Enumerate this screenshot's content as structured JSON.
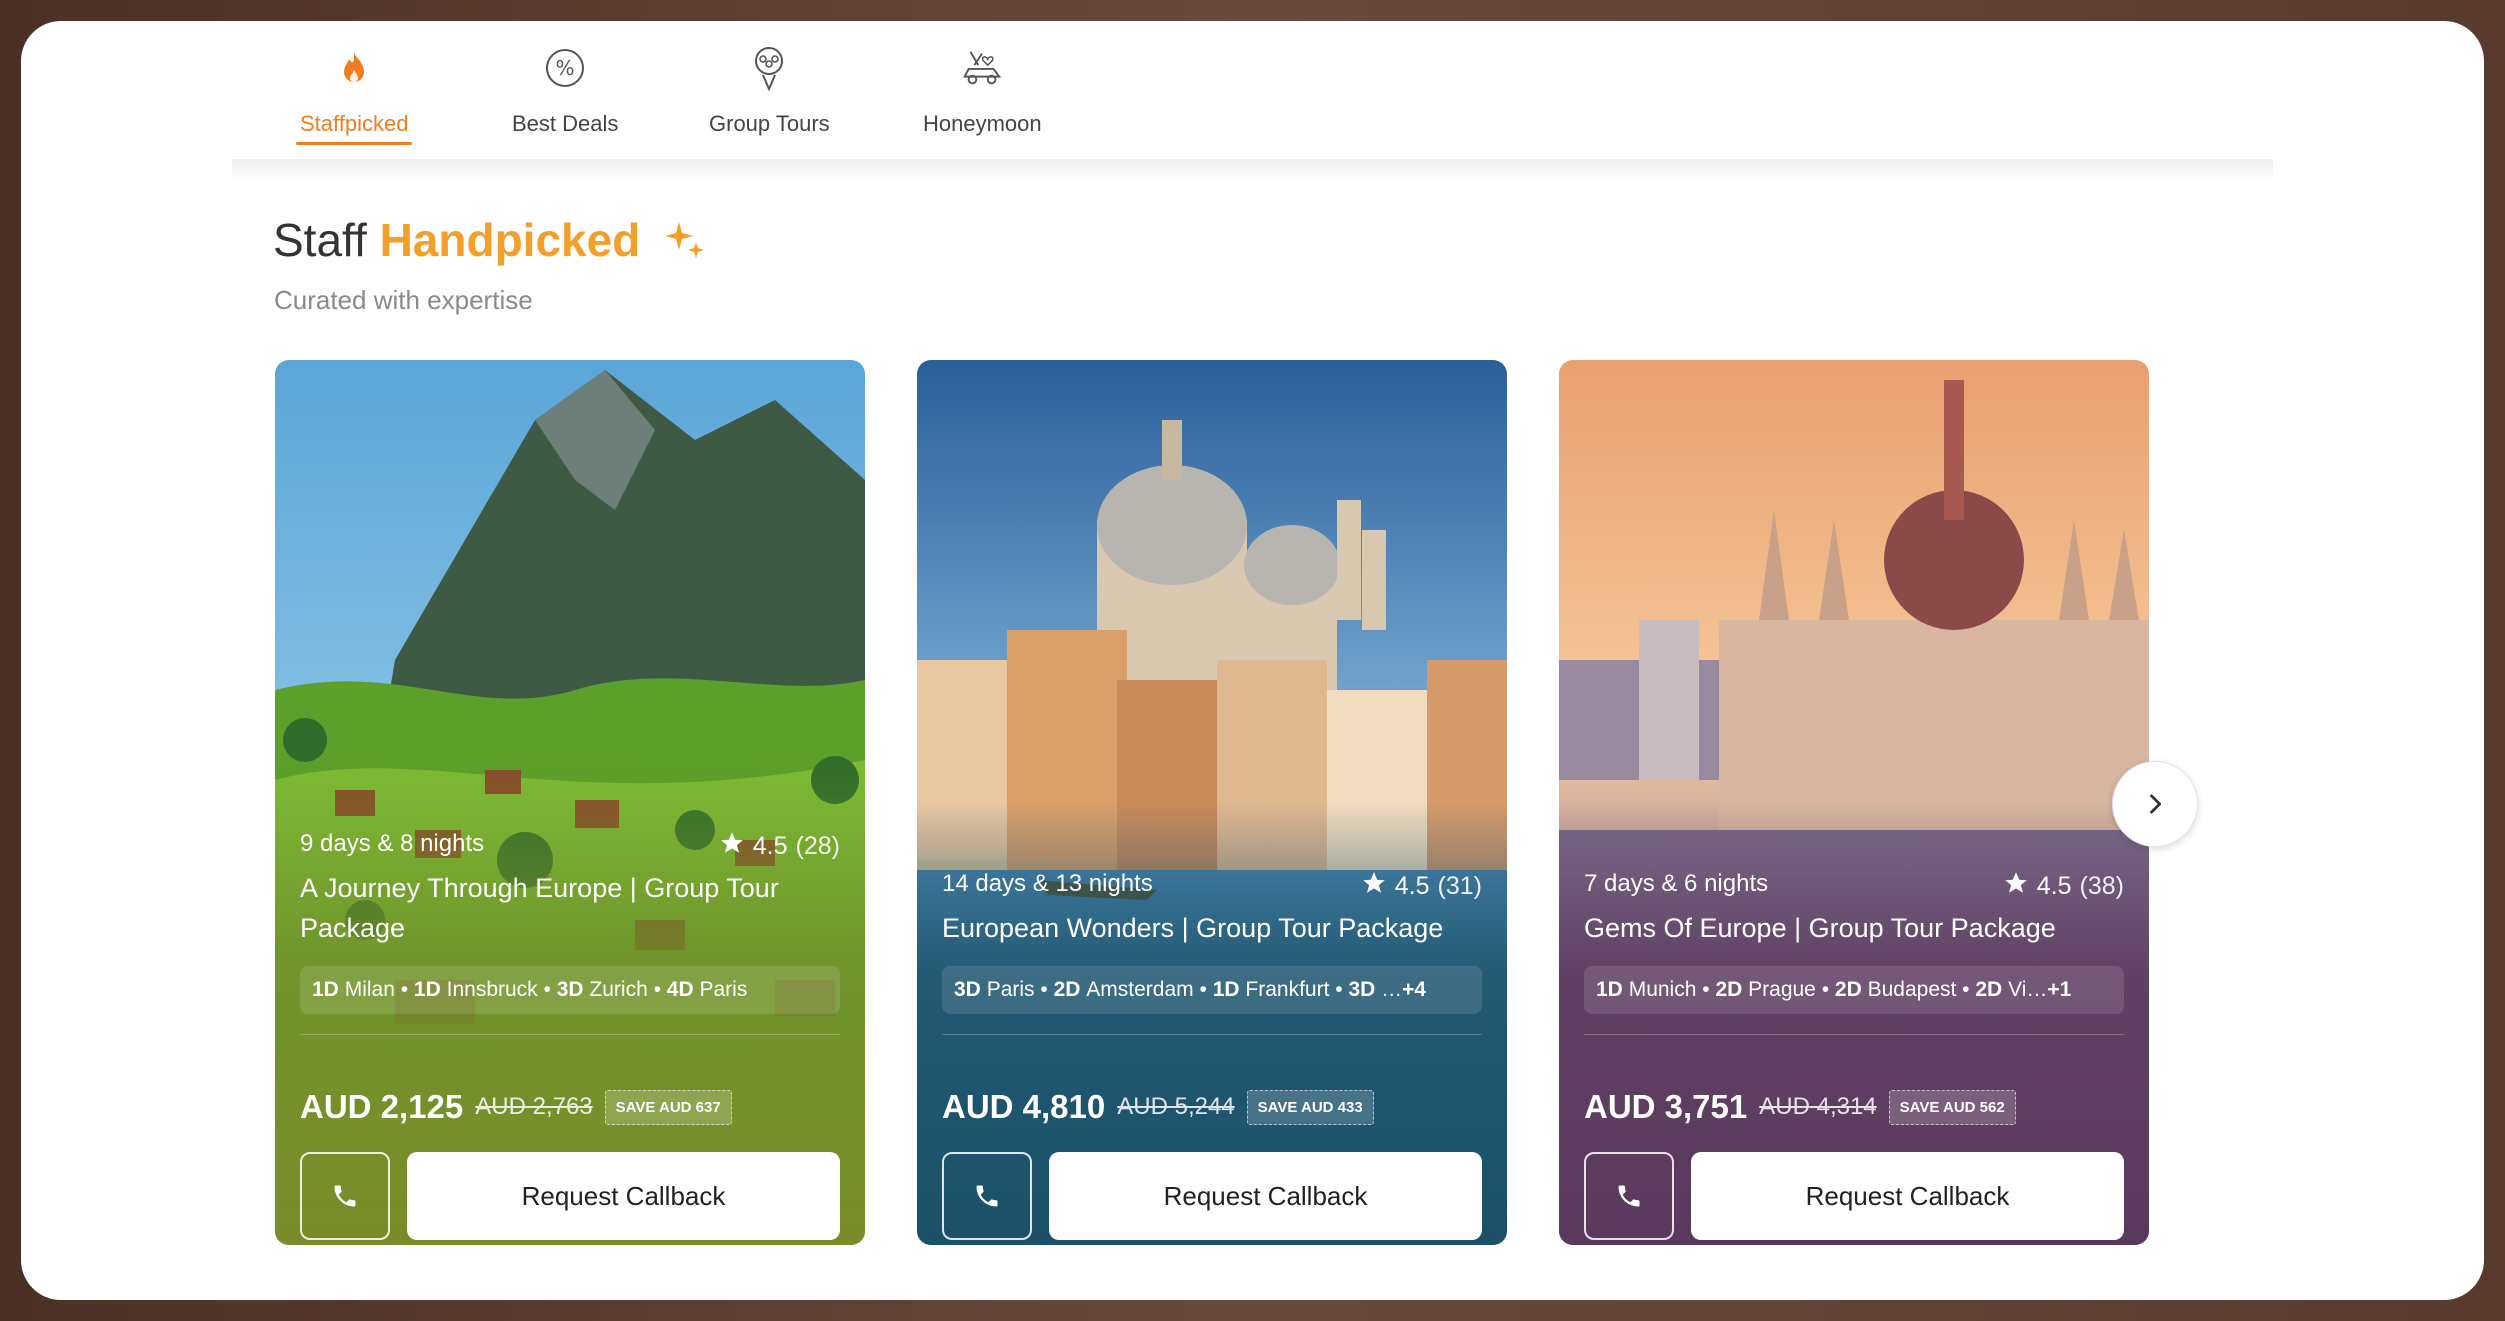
{
  "tabs": [
    {
      "label": "Staffpicked",
      "icon": "flame-icon",
      "active": true
    },
    {
      "label": "Best Deals",
      "icon": "percent-icon",
      "active": false
    },
    {
      "label": "Group Tours",
      "icon": "group-tour-icon",
      "active": false
    },
    {
      "label": "Honeymoon",
      "icon": "honeymoon-car-icon",
      "active": false
    }
  ],
  "section": {
    "title_plain": "Staff",
    "title_accent": "Handpicked",
    "subtitle": "Curated with expertise"
  },
  "cards": [
    {
      "duration": "9 days & 8 nights",
      "rating": "4.5",
      "reviews": "(28)",
      "title": "A Journey Through Europe | Group Tour Package",
      "cities": [
        {
          "days": "1D",
          "city": "Milan"
        },
        {
          "days": "1D",
          "city": "Innsbruck"
        },
        {
          "days": "3D",
          "city": "Zurich"
        },
        {
          "days": "4D",
          "city": "Paris"
        }
      ],
      "cities_more": "",
      "price": "AUD 2,125",
      "original_price": "AUD 2,763",
      "save": "SAVE AUD 637",
      "cta": "Request Callback",
      "theme": "#7a8c2a",
      "image": "swiss-alps-village"
    },
    {
      "duration": "14 days & 13 nights",
      "rating": "4.5",
      "reviews": "(31)",
      "title": "European Wonders | Group Tour Package",
      "cities": [
        {
          "days": "3D",
          "city": "Paris"
        },
        {
          "days": "2D",
          "city": "Amsterdam"
        },
        {
          "days": "1D",
          "city": "Frankfurt"
        },
        {
          "days": "3D",
          "city": "…"
        }
      ],
      "cities_more": "+4",
      "price": "AUD 4,810",
      "original_price": "AUD 5,244",
      "save": "SAVE AUD 433",
      "cta": "Request Callback",
      "theme": "#1b5068",
      "image": "venice-grand-canal"
    },
    {
      "duration": "7 days & 6 nights",
      "rating": "4.5",
      "reviews": "(38)",
      "title": "Gems Of Europe | Group Tour Package",
      "cities": [
        {
          "days": "1D",
          "city": "Munich"
        },
        {
          "days": "2D",
          "city": "Prague"
        },
        {
          "days": "2D",
          "city": "Budapest"
        },
        {
          "days": "2D",
          "city": "Vi…"
        }
      ],
      "cities_more": "+1",
      "price": "AUD 3,751",
      "original_price": "AUD 4,314",
      "save": "SAVE AUD 562",
      "cta": "Request Callback",
      "theme": "#5a3a5c",
      "image": "budapest-parliament"
    }
  ],
  "colors": {
    "accent_orange": "#f07e1e",
    "accent_gold": "#f2a02a"
  }
}
